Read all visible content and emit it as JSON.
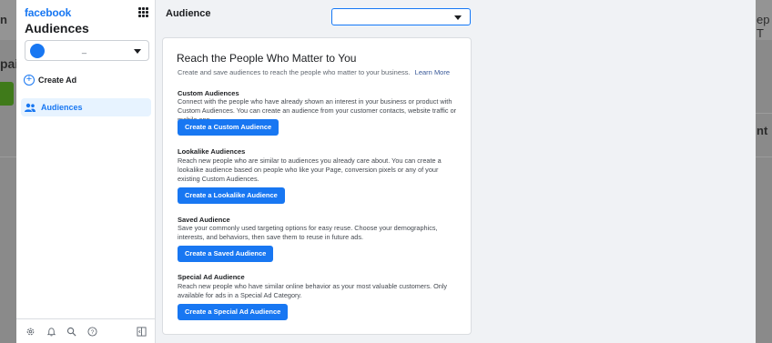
{
  "background": {
    "left_fragments": [
      "n",
      "paig"
    ],
    "right_fragments": [
      "ep T",
      "nt"
    ]
  },
  "sidebar": {
    "brand": "facebook",
    "title": "Audiences",
    "account_name": "_",
    "create_ad_label": "Create Ad",
    "nav_audiences_label": "Audiences",
    "footer_icons": [
      "settings-icon",
      "bell-icon",
      "search-icon",
      "help-icon",
      "panel-toggle-icon"
    ]
  },
  "header": {
    "title": "Audience",
    "select_value": ""
  },
  "card": {
    "title": "Reach the People Who Matter to You",
    "subtitle": "Create and save audiences to reach the people who matter to your business.",
    "learn_more": "Learn More",
    "sections": [
      {
        "title": "Custom Audiences",
        "description": "Connect with the people who have already shown an interest in your business or product with Custom Audiences. You can create an audience from your customer contacts, website traffic or mobile app.",
        "button": "Create a Custom Audience"
      },
      {
        "title": "Lookalike Audiences",
        "description": "Reach new people who are similar to audiences you already care about. You can create a lookalike audience based on people who like your Page, conversion pixels or any of your existing Custom Audiences.",
        "button": "Create a Lookalike Audience"
      },
      {
        "title": "Saved Audience",
        "description": "Save your commonly used targeting options for easy reuse. Choose your demographics, interests, and behaviors, then save them to reuse in future ads.",
        "button": "Create a Saved Audience"
      },
      {
        "title": "Special Ad Audience",
        "description": "Reach new people who have similar online behavior as your most valuable customers. Only available for ads in a Special Ad Category.",
        "button": "Create a Special Ad Audience"
      }
    ]
  },
  "colors": {
    "accent": "#1877f2",
    "selected_nav_bg": "#e7f3ff",
    "page_bg": "#f0f2f5"
  }
}
